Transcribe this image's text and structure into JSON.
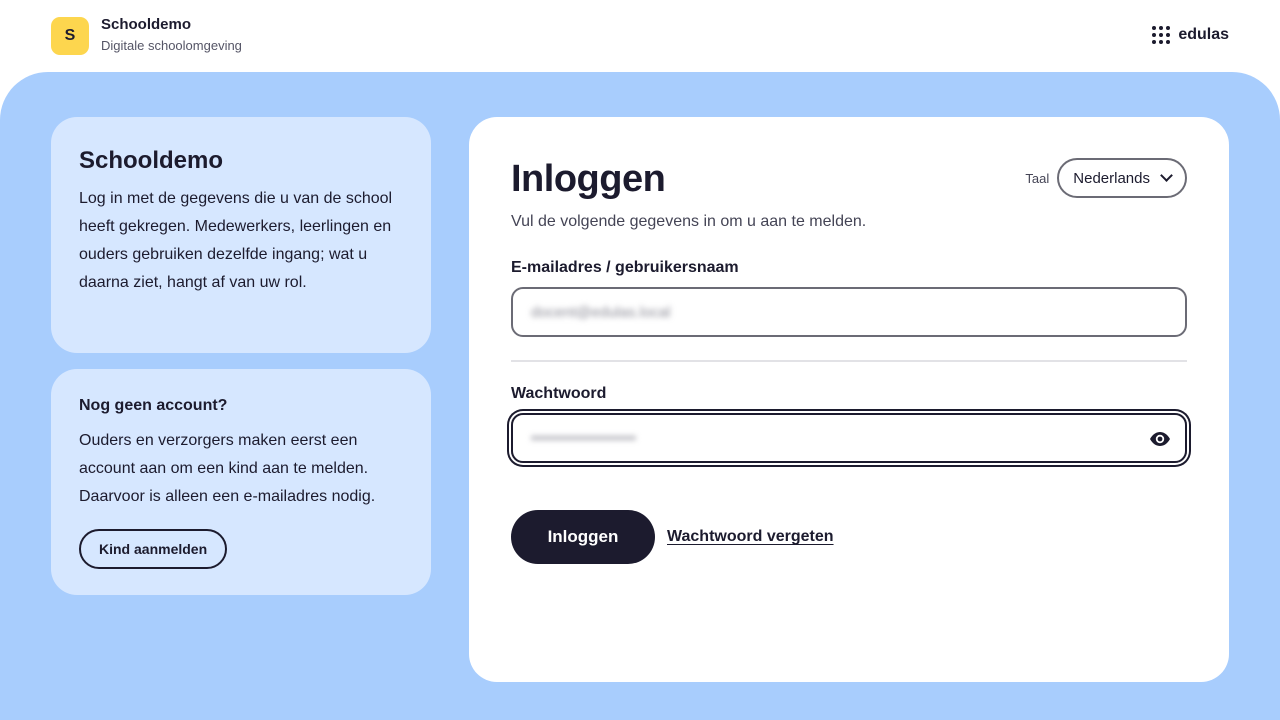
{
  "header": {
    "badge_letter": "S",
    "school_name": "Schooldemo",
    "school_subtitle": "Digitale schoolomgeving",
    "brand_name": "edulas",
    "brand_icon": "grid-dots-icon"
  },
  "info_card": {
    "title": "Schooldemo",
    "text": "Log in met de gegevens die u van de school heeft gekregen. Medewerkers, leerlingen en ouders gebruiken dezelfde ingang; wat u daarna ziet, hangt af van uw rol."
  },
  "account_card": {
    "title": "Nog geen account?",
    "text": "Ouders en verzorgers maken eerst een account aan om een kind aan te melden. Daarvoor is alleen een e-mailadres nodig.",
    "button_label": "Kind aanmelden"
  },
  "login": {
    "title": "Inloggen",
    "subtitle": "Vul de volgende gegevens in om u aan te melden.",
    "language_label": "Taal",
    "language_value": "Nederlands",
    "email_label": "E-mailadres / gebruikersnaam",
    "email_value": "docent@edulas.local",
    "password_label": "Wachtwoord",
    "password_value": "••••••••••••••••••••",
    "submit_label": "Inloggen",
    "forgot_label": "Wachtwoord vergeten"
  },
  "colors": {
    "accent_yellow": "#fdd64e",
    "stage_blue": "#a8cdfd",
    "card_blue": "#d6e7ff",
    "primary_dark": "#1c1b2e"
  }
}
